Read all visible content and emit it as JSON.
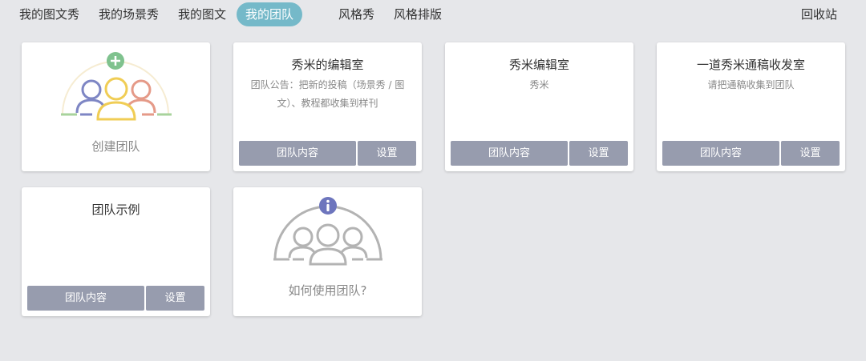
{
  "nav": {
    "items": [
      {
        "label": "我的图文秀"
      },
      {
        "label": "我的场景秀"
      },
      {
        "label": "我的图文"
      },
      {
        "label": "我的团队"
      },
      {
        "label": "风格秀"
      },
      {
        "label": "风格排版"
      }
    ],
    "active_index": 3,
    "recycle_label": "回收站"
  },
  "create_card": {
    "label": "创建团队",
    "icons": [
      "plus-icon",
      "team-members-icon"
    ]
  },
  "teams": [
    {
      "title": "秀米的编辑室",
      "desc": "团队公告：把新的投稿（场景秀 / 图文）、教程都收集到样刊",
      "content_label": "团队内容",
      "settings_label": "设置"
    },
    {
      "title": "秀米编辑室",
      "desc": "秀米",
      "content_label": "团队内容",
      "settings_label": "设置"
    },
    {
      "title": "一道秀米通稿收发室",
      "desc": "请把通稿收集到团队",
      "content_label": "团队内容",
      "settings_label": "设置"
    },
    {
      "title": "团队示例",
      "desc": "",
      "content_label": "团队内容",
      "settings_label": "设置"
    }
  ],
  "help_card": {
    "label": "如何使用团队?",
    "icons": [
      "info-icon",
      "team-members-icon"
    ]
  },
  "colors": {
    "background": "#e6e7ea",
    "nav_active": "#75b9c9",
    "button": "#979cae",
    "plus_green": "#7fc28e",
    "member_blue": "#7e86c4",
    "member_yellow": "#f0cd55",
    "member_red": "#e59a88",
    "info_blue": "#6d75bd",
    "help_gray": "#b3b3b3"
  }
}
